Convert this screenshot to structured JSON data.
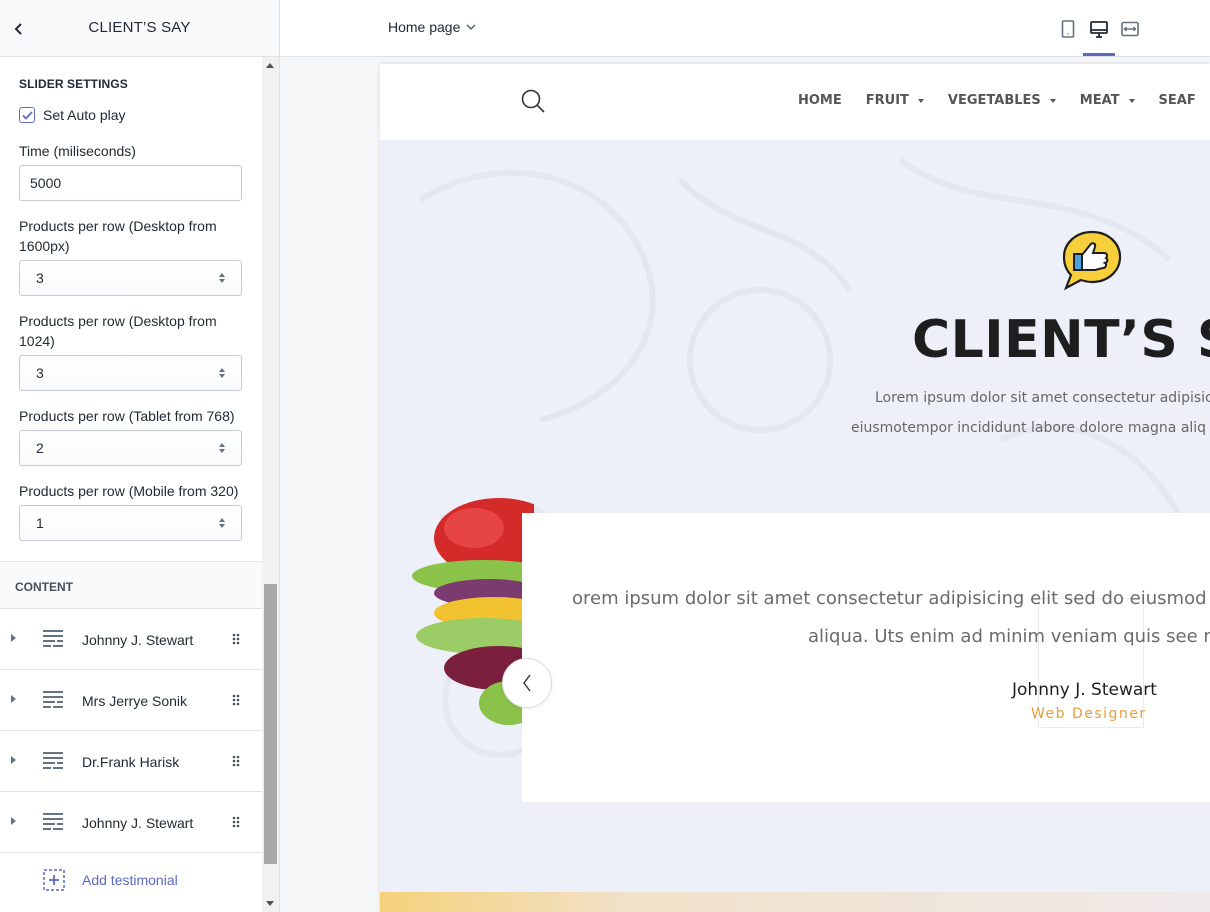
{
  "sidebar": {
    "title": "CLIENT’S SAY",
    "slider_settings": {
      "heading": "SLIDER SETTINGS",
      "autoplay_label": "Set Auto play",
      "autoplay_checked": true,
      "time_label": "Time (miliseconds)",
      "time_value": "5000",
      "desktop1600_label": "Products per row (Desktop from 1600px)",
      "desktop1600_value": "3",
      "desktop1024_label": "Products per row (Desktop from 1024)",
      "desktop1024_value": "3",
      "tablet_label": "Products per row (Tablet from 768)",
      "tablet_value": "2",
      "mobile_label": "Products per row (Mobile from 320)",
      "mobile_value": "1"
    },
    "content": {
      "heading": "CONTENT",
      "items": [
        {
          "label": "Johnny J. Stewart"
        },
        {
          "label": "Mrs Jerrye Sonik"
        },
        {
          "label": "Dr.Frank Harisk"
        },
        {
          "label": "Johnny J. Stewart"
        }
      ],
      "add_label": "Add testimonial"
    }
  },
  "topbar": {
    "page_select": "Home page",
    "active_view": "desktop"
  },
  "preview": {
    "nav": [
      "HOME",
      "FRUIT",
      "VEGETABLES",
      "MEAT",
      "SEAF"
    ],
    "hero_title": "CLIENT’S SA",
    "hero_sub_1": "Lorem ipsum dolor sit amet consectetur adipisic",
    "hero_sub_2": "eiusmotempor incididunt labore dolore magna aliq",
    "quote_line_1": "orem ipsum dolor sit amet consectetur adipisicing elit sed do eiusmod t",
    "quote_line_2": "aliqua. Uts enim ad minim veniam quis see no",
    "author": "Johnny J. Stewart",
    "role": "Web Designer"
  },
  "colors": {
    "accent": "#5c6ac4",
    "role_text": "#e69d38",
    "icon_yellow": "#f7cf3b"
  }
}
